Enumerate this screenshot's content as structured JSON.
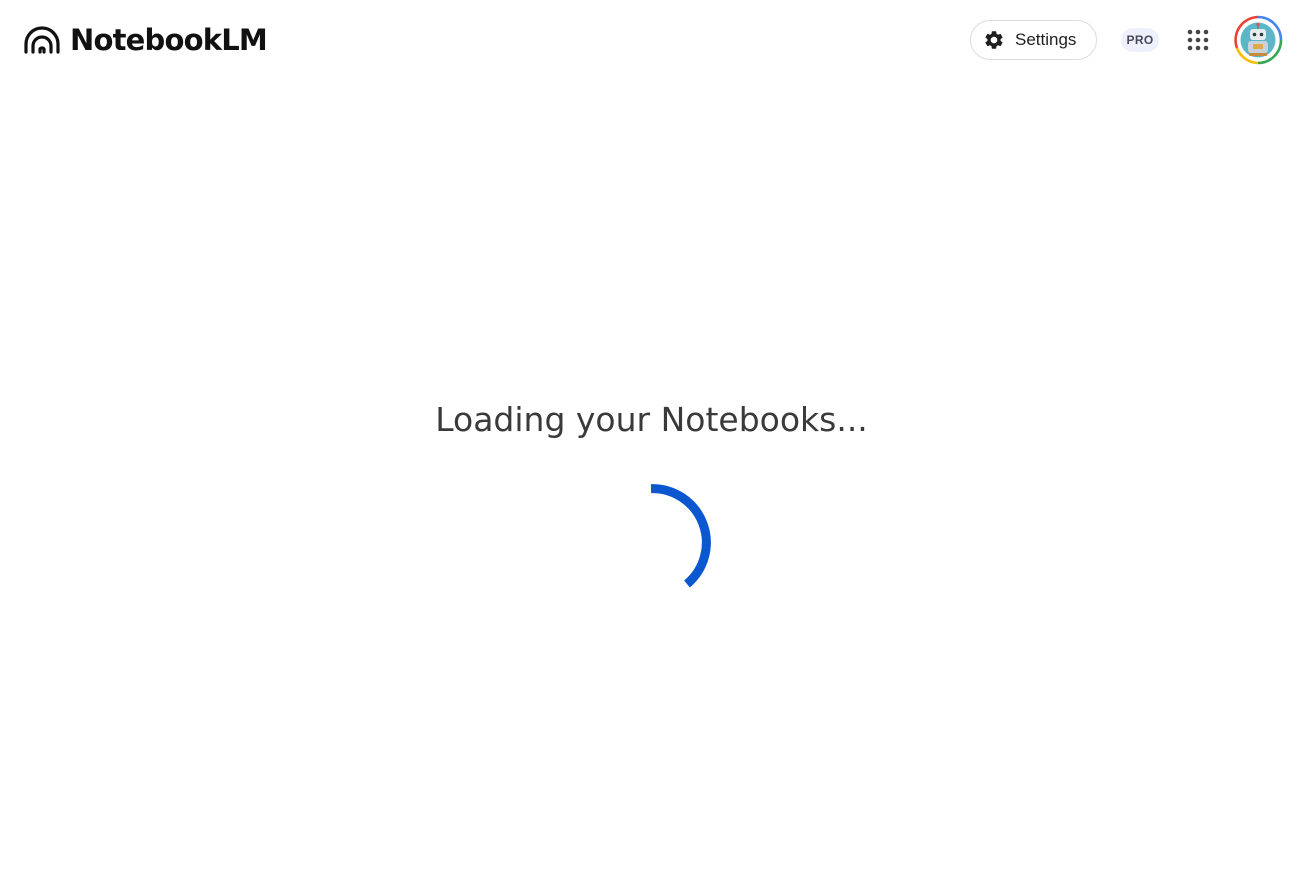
{
  "header": {
    "app_name": "NotebookLM",
    "logo_icon": "notebooklm-logo-icon",
    "settings": {
      "label": "Settings",
      "icon": "gear-icon"
    },
    "pro_badge": "PRO",
    "apps_icon": "apps-grid-icon",
    "avatar_icon": "account-avatar"
  },
  "main": {
    "loading_text": "Loading your Notebooks...",
    "spinner_icon": "loading-spinner-icon"
  },
  "colors": {
    "spinner": "#0b57d0",
    "badge_bg": "#eef0fb",
    "border": "#dadce0"
  }
}
